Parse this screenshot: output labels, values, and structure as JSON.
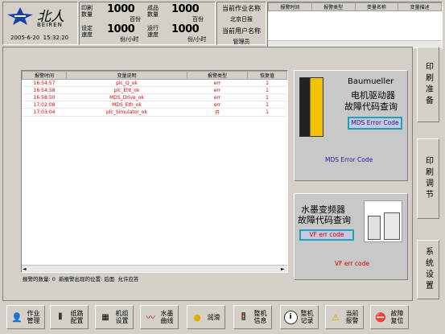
{
  "logo": {
    "brand_cn": "北人",
    "brand_en": "BEIREN",
    "datetime": "2005-6-20  15:32:20"
  },
  "stats": [
    {
      "label": "印刷\n数量",
      "value": "1000",
      "unit": "百份"
    },
    {
      "label": "成品\n数量",
      "value": "1000",
      "unit": "百份"
    },
    {
      "label": "设定\n速度",
      "value": "1000",
      "unit": "份/小时"
    },
    {
      "label": "运行\n速度",
      "value": "1000",
      "unit": "份/小时"
    }
  ],
  "job": {
    "title": "当前作业名称",
    "name": "北京日报",
    "user_title": "当前用户名称",
    "user": "管理员"
  },
  "top_table": {
    "headers": [
      "报警时间",
      "报警类型",
      "变量名称",
      "变量描述"
    ]
  },
  "alarm_list": {
    "headers": [
      "报警时间",
      "变量说明",
      "报警类型",
      "恢复值"
    ],
    "rows": [
      [
        "16:54:57",
        "plc_Q_ok",
        "err",
        "1"
      ],
      [
        "16:54:58",
        "plc_Eht_ok",
        "err",
        "1"
      ],
      [
        "16:58:50",
        "MDS_Drive_ok",
        "err",
        "1"
      ],
      [
        "17:02:08",
        "MDS_Eth_ok",
        "err",
        "1"
      ],
      [
        "17:03:04",
        "plc_Simulator_ok",
        "开",
        "1"
      ]
    ],
    "footer": "报警的数量: 0  新报警出现的位置: 后面  允许应答"
  },
  "mds_panel": {
    "brand": "Baumueller",
    "title1": "电机驱动器",
    "title2": "故障代码查询",
    "button": "MDS Error Code",
    "caption": "MDS Error Code"
  },
  "vf_panel": {
    "title1": "水墨变频器",
    "title2": "故障代码查询",
    "button": "VF err code",
    "caption": "VF err code"
  },
  "side_buttons": [
    "印刷准备",
    "印刷调节",
    "系统设置"
  ],
  "bottom_buttons": [
    {
      "label": "作业\n管理",
      "icon": "person-icon"
    },
    {
      "label": "纸路\n配置",
      "icon": "paper-path-icon"
    },
    {
      "label": "机组\n设置",
      "icon": "unit-config-icon"
    },
    {
      "label": "水墨\n曲线",
      "icon": "curve-icon"
    },
    {
      "label": "润滑",
      "icon": "oil-drop-icon"
    },
    {
      "label": "整机\n信息",
      "icon": "traffic-light-icon"
    },
    {
      "label": "整机\n记录",
      "icon": "info-icon"
    },
    {
      "label": "当前\n报警",
      "icon": "warning-icon"
    },
    {
      "label": "故障\n复位",
      "icon": "reset-icon"
    }
  ],
  "colors": {
    "bg": "#d4d0c8",
    "alarm_red": "#d40000",
    "brand_blue": "#1a3fa8",
    "vf_caption": "#d40000"
  }
}
